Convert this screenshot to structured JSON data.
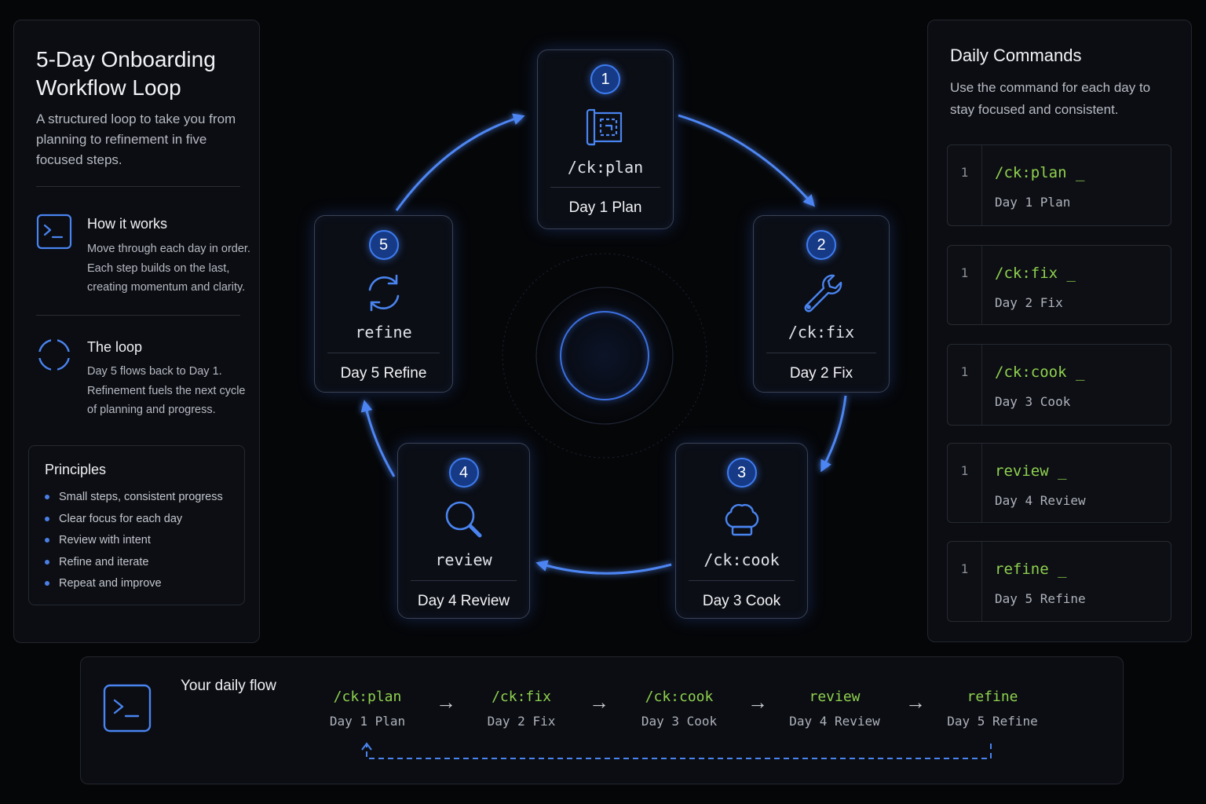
{
  "left_panel": {
    "title": "5-Day Onboarding Workflow Loop",
    "subtitle": "A structured loop to take you from planning to refinement in five focused steps.",
    "how": {
      "icon": "terminal-icon",
      "title": "How it works",
      "text": "Move through each day in order. Each step builds on the last, creating momentum and clarity."
    },
    "loop": {
      "icon": "loop-icon",
      "title": "The loop",
      "text": "Day 5 flows back to Day 1. Refinement fuels the next cycle of planning and progress."
    },
    "principles": {
      "title": "Principles",
      "items": [
        "Small steps, consistent progress",
        "Clear focus for each day",
        "Review with intent",
        "Refine and iterate",
        "Repeat and improve"
      ]
    }
  },
  "cycle": {
    "steps": [
      {
        "number": "1",
        "command": "/ck:plan",
        "label": "Day 1 Plan",
        "icon": "blueprint-icon"
      },
      {
        "number": "2",
        "command": "/ck:fix",
        "label": "Day 2 Fix",
        "icon": "wrench-icon"
      },
      {
        "number": "3",
        "command": "/ck:cook",
        "label": "Day 3 Cook",
        "icon": "chef-hat-icon"
      },
      {
        "number": "4",
        "command": "review",
        "label": "Day 4 Review",
        "icon": "magnifier-icon"
      },
      {
        "number": "5",
        "command": "refine",
        "label": "Day 5 Refine",
        "icon": "refresh-icon"
      }
    ]
  },
  "right_panel": {
    "title": "Daily Commands",
    "subtitle": "Use the command for each day to stay focused and consistent.",
    "commands": [
      {
        "line": "1",
        "command": "/ck:plan _",
        "label": "Day 1 Plan"
      },
      {
        "line": "1",
        "command": "/ck:fix _",
        "label": "Day 2 Fix"
      },
      {
        "line": "1",
        "command": "/ck:cook _",
        "label": "Day 3 Cook"
      },
      {
        "line": "1",
        "command": "review _",
        "label": "Day 4 Review"
      },
      {
        "line": "1",
        "command": "refine _",
        "label": "Day 5 Refine"
      }
    ]
  },
  "daily_flow": {
    "title": "Your daily flow",
    "icon": "terminal-icon",
    "items": [
      {
        "command": "/ck:plan",
        "label": "Day 1 Plan"
      },
      {
        "command": "/ck:fix",
        "label": "Day 2 Fix"
      },
      {
        "command": "/ck:cook",
        "label": "Day 3 Cook"
      },
      {
        "command": "review",
        "label": "Day 4 Review"
      },
      {
        "command": "refine",
        "label": "Day 5 Refine"
      }
    ],
    "arrow": "→"
  },
  "colors": {
    "accent": "#3d7cf0",
    "command_green": "#8fd14f",
    "background": "#050608"
  }
}
